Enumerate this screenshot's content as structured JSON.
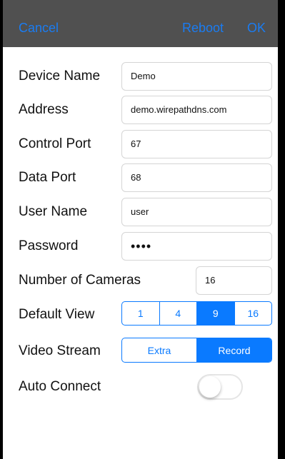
{
  "navbar": {
    "cancel_label": "Cancel",
    "reboot_label": "Reboot",
    "ok_label": "OK"
  },
  "form": {
    "device_name": {
      "label": "Device Name",
      "value": "Demo"
    },
    "address": {
      "label": "Address",
      "value": "demo.wirepathdns.com"
    },
    "control_port": {
      "label": "Control Port",
      "value": "67"
    },
    "data_port": {
      "label": "Data Port",
      "value": "68"
    },
    "user_name": {
      "label": "User Name",
      "value": "user"
    },
    "password": {
      "label": "Password",
      "value": "••••"
    },
    "number_of_cameras": {
      "label": "Number of Cameras",
      "value": "16"
    },
    "default_view": {
      "label": "Default View",
      "options": [
        "1",
        "4",
        "9",
        "16"
      ],
      "selected": "9"
    },
    "video_stream": {
      "label": "Video Stream",
      "options": [
        "Extra",
        "Record"
      ],
      "selected": "Record"
    },
    "auto_connect": {
      "label": "Auto Connect",
      "on": false
    }
  },
  "colors": {
    "accent": "#0a7aff",
    "navbar_bg": "#505050",
    "field_border": "#d5d5d5"
  }
}
